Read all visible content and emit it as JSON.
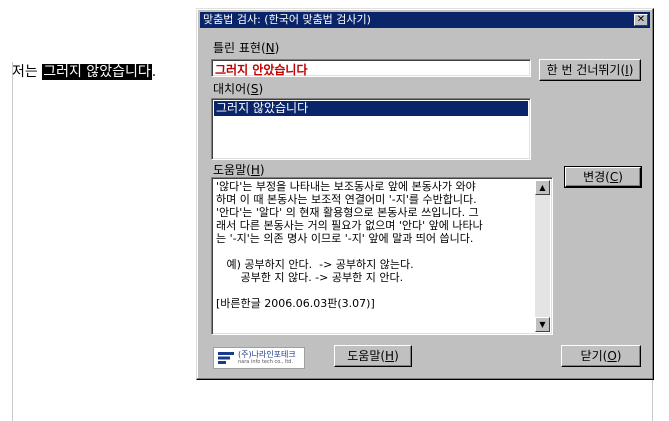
{
  "document": {
    "prefix": "저는 ",
    "selected": "그러지 않았습니다",
    "suffix": "."
  },
  "dialog": {
    "title": "맞춤법 검사: (한국어 맞춤법 검사기)",
    "close_glyph": "✕",
    "wrong_label": "틀린 표현",
    "wrong_key": "N",
    "wrong_value": "그러지 안았습니다",
    "suggest_label": "대치어",
    "suggest_key": "S",
    "suggestions": [
      "그러지 않았습니다"
    ],
    "help_label": "도움말",
    "help_key": "H",
    "help_lines": [
      "'않다'는 부정을 나타내는 보조동사로 앞에 본동사가 와야",
      "하며 이 때 본동사는 보조적 연결어미 '-지'를 수반합니다.",
      "'안다'는 '알다' 의 현재 활용형으로 본동사로 쓰입니다. 그",
      "래서 다른 본동사는 거의 필요가 없으며 '안다' 앞에 나타나",
      "는 '-지'는 의존 명사 이므로 '-지' 앞에 말과 띄어 씁니다.",
      "",
      "   예) 공부하지 안다.  -> 공부하지 않는다.",
      "       공부한 지 않다. -> 공부한 지 안다.",
      "",
      "[바른한글 2006.06.03판(3.07)]"
    ],
    "buttons": {
      "skip": {
        "text": "한 번 건너뛰기(",
        "key": "I",
        "end": ")"
      },
      "change": {
        "text": "변경(",
        "key": "C",
        "end": ")"
      },
      "help": {
        "text": "도움말(",
        "key": "H",
        "end": ")"
      },
      "close": {
        "text": "닫기(",
        "key": "O",
        "end": ")"
      }
    },
    "logo": {
      "name": "(주)나라인포테크",
      "sub": "nara info tech co., ltd."
    },
    "scroll_up_icon": "▲",
    "scroll_down_icon": "▼"
  },
  "colors": {
    "titlebar": "#0a246a",
    "error_text": "#c00000",
    "face": "#c0c0c0"
  }
}
